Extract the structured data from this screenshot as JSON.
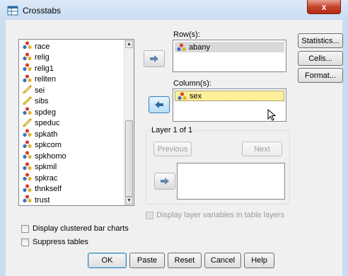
{
  "window": {
    "title": "Crosstabs",
    "close_glyph": "x"
  },
  "variables": {
    "items": [
      {
        "name": "race",
        "icon": "nominal-icon"
      },
      {
        "name": "relig",
        "icon": "nominal-icon"
      },
      {
        "name": "relig1",
        "icon": "nominal-icon"
      },
      {
        "name": "reliten",
        "icon": "nominal-icon"
      },
      {
        "name": "sei",
        "icon": "scale-icon"
      },
      {
        "name": "sibs",
        "icon": "scale-icon"
      },
      {
        "name": "spdeg",
        "icon": "nominal-icon"
      },
      {
        "name": "speduc",
        "icon": "scale-icon"
      },
      {
        "name": "spkath",
        "icon": "nominal-icon"
      },
      {
        "name": "spkcom",
        "icon": "nominal-icon"
      },
      {
        "name": "spkhomo",
        "icon": "nominal-icon"
      },
      {
        "name": "spkmil",
        "icon": "nominal-icon"
      },
      {
        "name": "spkrac",
        "icon": "nominal-icon"
      },
      {
        "name": "thnkself",
        "icon": "nominal-icon"
      },
      {
        "name": "trust",
        "icon": "nominal-icon"
      }
    ]
  },
  "rows": {
    "label": "Row(s):",
    "values": [
      "abany"
    ]
  },
  "columns": {
    "label": "Column(s):",
    "values": [
      "sex"
    ]
  },
  "layer": {
    "title": "Layer 1 of 1",
    "previous": "Previous",
    "next": "Next"
  },
  "side_buttons": {
    "statistics": "Statistics...",
    "cells": "Cells...",
    "format": "Format..."
  },
  "options": {
    "display_layer": "Display layer variables in table layers",
    "clustered_bar": "Display clustered bar charts",
    "suppress_tables": "Suppress tables"
  },
  "footer": {
    "ok": "OK",
    "paste": "Paste",
    "reset": "Reset",
    "cancel": "Cancel",
    "help": "Help"
  },
  "colors": {
    "accent": "#3c7fb1",
    "title_bar": "#c9dcf1",
    "close": "#c7432c",
    "selection": "#cfe6fb"
  }
}
